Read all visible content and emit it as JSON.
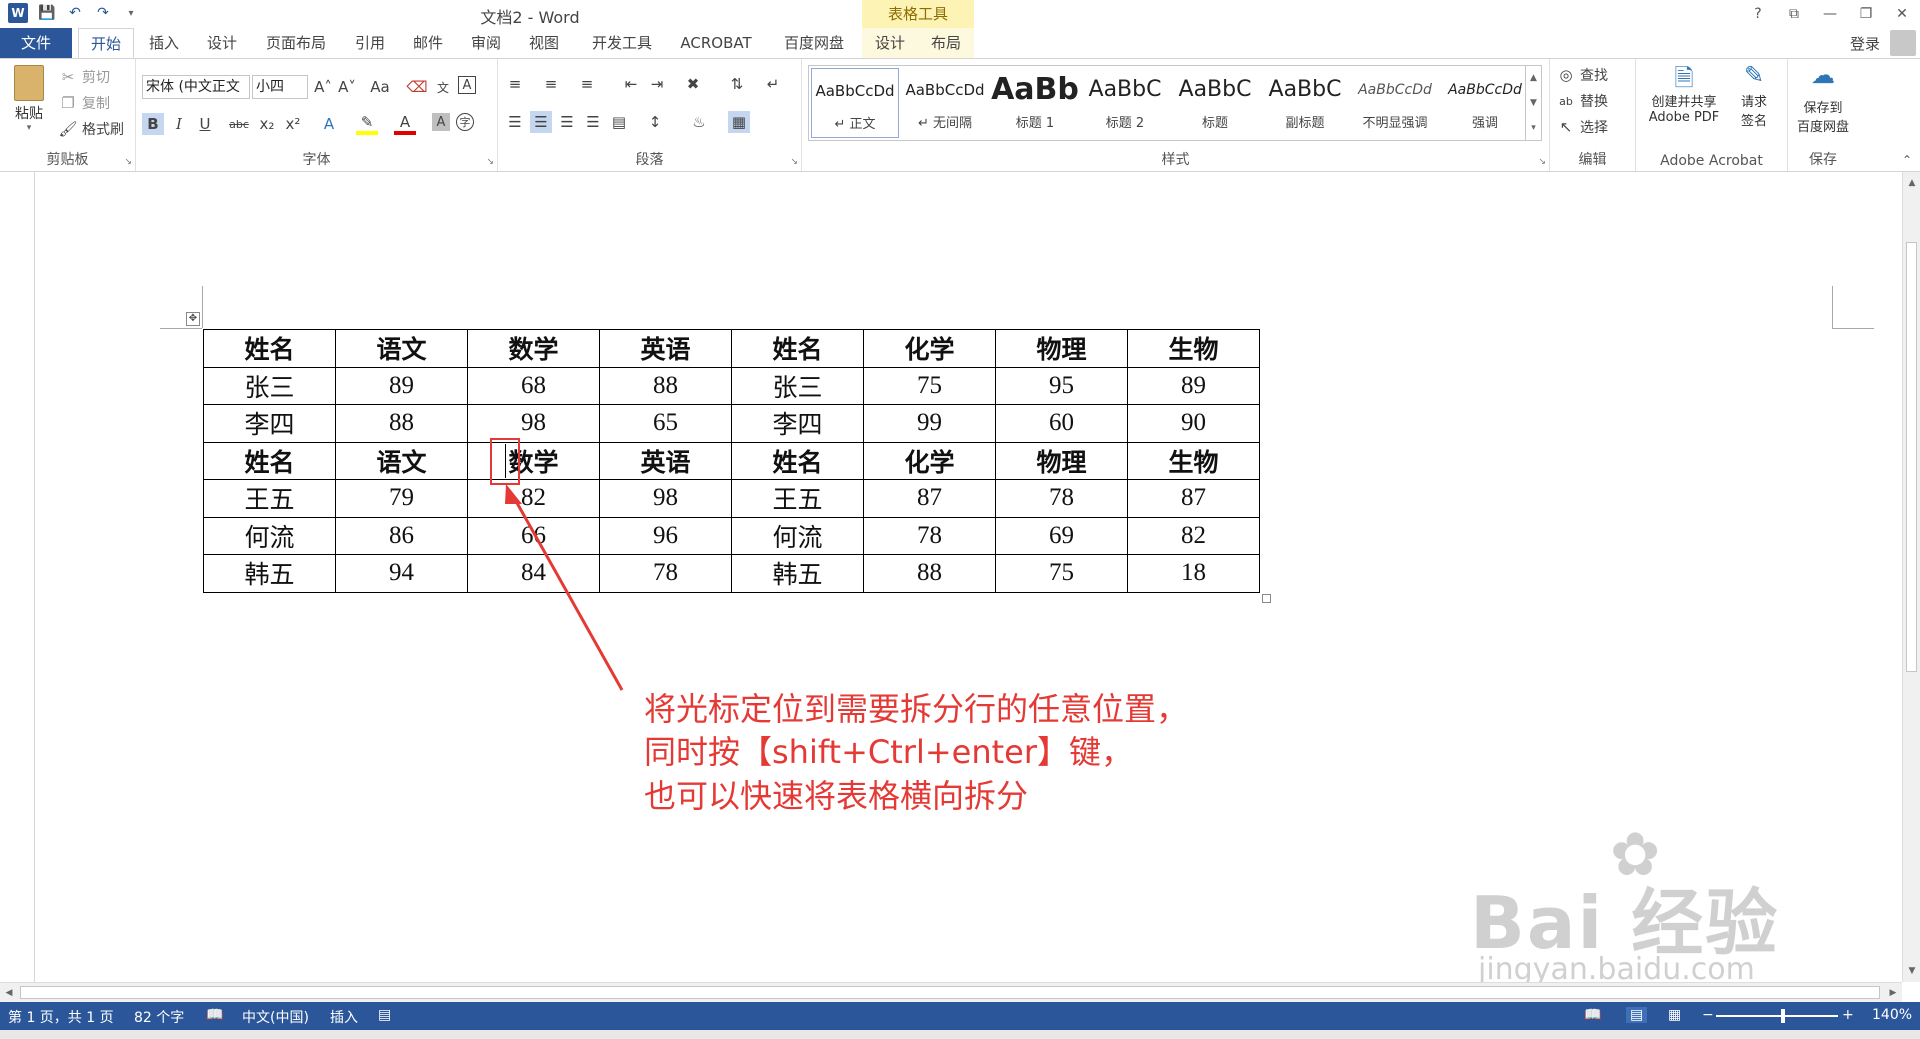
{
  "window": {
    "title": "文档2 - Word",
    "context_tab_title": "表格工具",
    "controls": [
      "?",
      "⧉",
      "—",
      "❐",
      "✕"
    ]
  },
  "tabs": {
    "file": "文件",
    "home": "开始",
    "insert": "插入",
    "design": "设计",
    "layout": "页面布局",
    "references": "引用",
    "mailings": "邮件",
    "review": "审阅",
    "view": "视图",
    "developer": "开发工具",
    "acrobat": "ACROBAT",
    "baidu": "百度网盘",
    "table_design": "设计",
    "table_layout": "布局",
    "login": "登录"
  },
  "ribbon": {
    "clipboard": {
      "label": "剪贴板",
      "paste": "粘贴",
      "cut": "剪切",
      "copy": "复制",
      "format_painter": "格式刷"
    },
    "font": {
      "label": "字体",
      "font_name": "宋体 (中文正文",
      "font_size": "小四",
      "bold": "B",
      "italic": "I",
      "underline": "U",
      "strike": "abc",
      "sub": "x₂",
      "sup": "x²",
      "change_case": "Aa"
    },
    "paragraph": {
      "label": "段落"
    },
    "styles": {
      "label": "样式",
      "items": [
        {
          "sample": "AaBbCcDd",
          "name": "↵ 正文"
        },
        {
          "sample": "AaBbCcDd",
          "name": "↵ 无间隔"
        },
        {
          "sample": "AaBb",
          "name": "标题 1"
        },
        {
          "sample": "AaBbC",
          "name": "标题 2"
        },
        {
          "sample": "AaBbC",
          "name": "标题"
        },
        {
          "sample": "AaBbC",
          "name": "副标题"
        },
        {
          "sample": "AaBbCcDd",
          "name": "不明显强调"
        },
        {
          "sample": "AaBbCcDd",
          "name": "强调"
        }
      ]
    },
    "editing": {
      "label": "编辑",
      "find": "查找",
      "replace": "替换",
      "select": "选择"
    },
    "acrobat": {
      "label": "Adobe Acrobat",
      "create_line1": "创建并共享",
      "create_line2": "Adobe PDF",
      "sign_line1": "请求",
      "sign_line2": "签名"
    },
    "save": {
      "label": "保存",
      "line1": "保存到",
      "line2": "百度网盘"
    }
  },
  "table": {
    "rows": [
      [
        "姓名",
        "语文",
        "数学",
        "英语",
        "姓名",
        "化学",
        "物理",
        "生物"
      ],
      [
        "张三",
        "89",
        "68",
        "88",
        "张三",
        "75",
        "95",
        "89"
      ],
      [
        "李四",
        "88",
        "98",
        "65",
        "李四",
        "99",
        "60",
        "90"
      ],
      [
        "姓名",
        "语文",
        "数学",
        "英语",
        "姓名",
        "化学",
        "物理",
        "生物"
      ],
      [
        "王五",
        "79",
        "82",
        "98",
        "王五",
        "87",
        "78",
        "87"
      ],
      [
        "何流",
        "86",
        "66",
        "96",
        "何流",
        "78",
        "69",
        "82"
      ],
      [
        "韩五",
        "94",
        "84",
        "78",
        "韩五",
        "88",
        "75",
        "18"
      ]
    ],
    "header_rows": [
      0,
      3
    ]
  },
  "annotation": {
    "lines": [
      "将光标定位到需要拆分行的任意位置，",
      "同时按【shift+Ctrl+enter】键，",
      "也可以快速将表格横向拆分"
    ],
    "color": "#e53935"
  },
  "watermark": {
    "main": "Bai 经验",
    "sub": "jingyan.baidu.com"
  },
  "statusbar": {
    "page": "第 1 页，共 1 页",
    "words": "82 个字",
    "language": "中文(中国)",
    "mode": "插入",
    "zoom": "140%"
  },
  "colors": {
    "accent": "#2b579a",
    "context_tab": "#fdf3b4",
    "annotation": "#e53935"
  }
}
